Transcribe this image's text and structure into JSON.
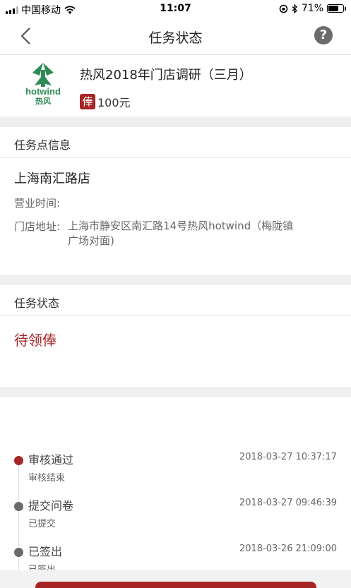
{
  "status_bar": {
    "carrier": "中国移动",
    "time": "11:07",
    "battery": "71%",
    "battery_level": 0.71
  },
  "nav": {
    "title": "任务状态",
    "help_label": "?"
  },
  "task": {
    "brand_en": "hotwind",
    "brand_cn": "热风",
    "title": "热风2018年门店调研（三月）",
    "reward_badge": "俸",
    "reward_amount": "100元"
  },
  "store_section": {
    "header": "任务点信息",
    "store_name": "上海南汇路店",
    "hours_label": "营业时间:",
    "hours_value": "",
    "address_label": "门店地址:",
    "address_value": "上海市静安区南汇路14号热风hotwind（梅陇镇广场对面)"
  },
  "status_section": {
    "header": "任务状态",
    "status": "待领俸"
  },
  "timeline": [
    {
      "title": "审核通过",
      "sub": "审核结束",
      "time": "2018-03-27 10:37:17",
      "active": true
    },
    {
      "title": "提交问卷",
      "sub": "已提交",
      "time": "2018-03-27 09:46:39",
      "active": false
    },
    {
      "title": "已签出",
      "sub": "已签出",
      "time": "2018-03-26 21:09:00",
      "active": false
    }
  ],
  "colors": {
    "accent": "#a62626",
    "brand_green": "#2e8b57"
  }
}
